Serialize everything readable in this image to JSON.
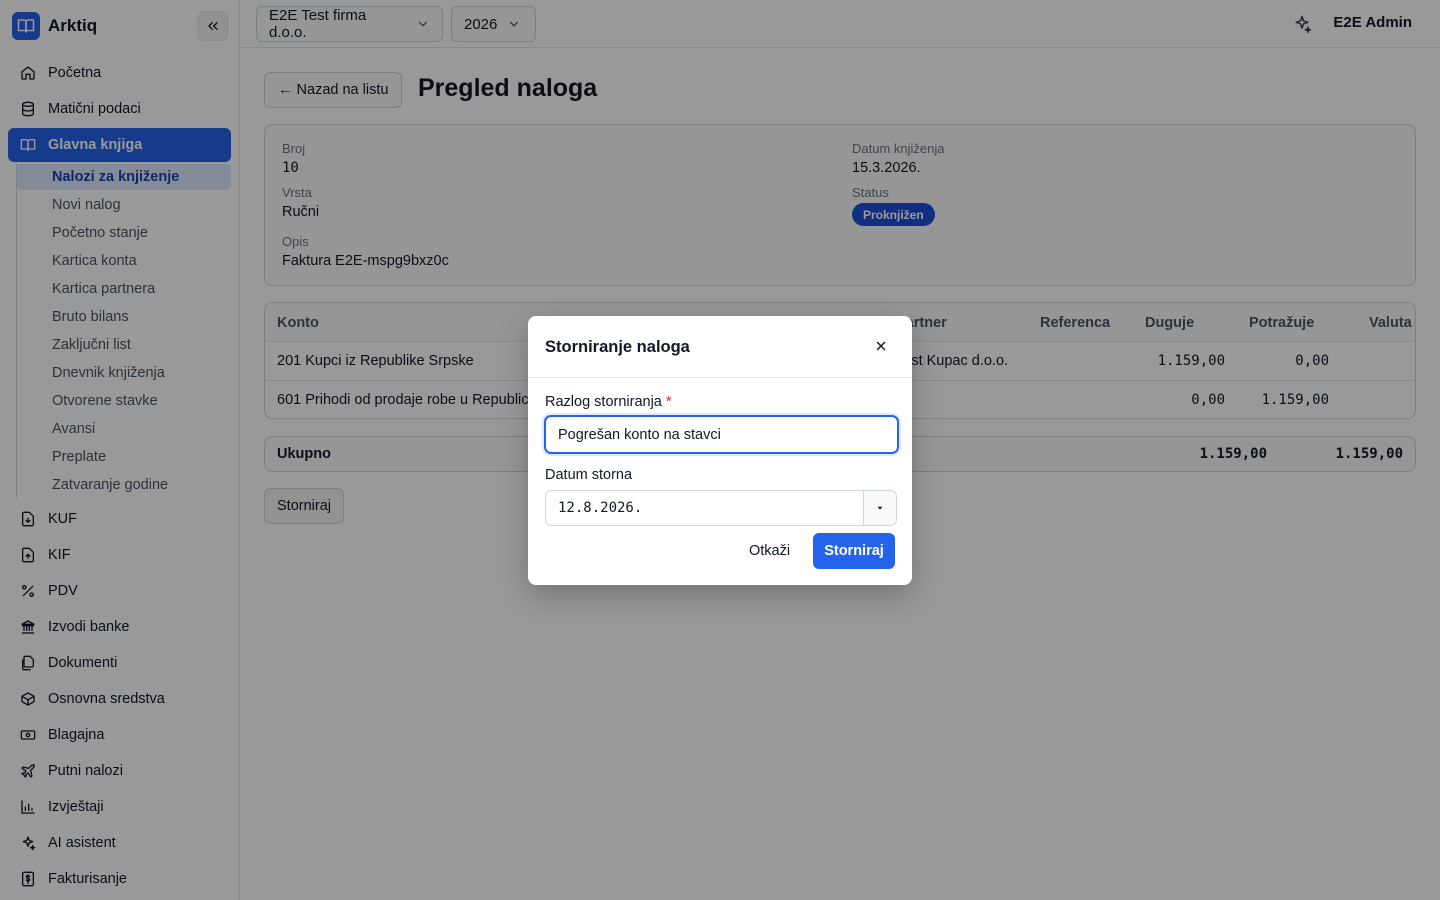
{
  "app": {
    "name": "Arktiq"
  },
  "topbar": {
    "company": "E2E Test firma d.o.o.",
    "year": "2026",
    "user": "E2E Admin"
  },
  "sidebar": {
    "items": [
      {
        "label": "Početna",
        "icon": "home-icon"
      },
      {
        "label": "Matični podaci",
        "icon": "database-icon"
      },
      {
        "label": "Glavna knjiga",
        "icon": "book-icon",
        "active": true
      },
      {
        "label": "KUF",
        "icon": "file-down-icon"
      },
      {
        "label": "KIF",
        "icon": "file-up-icon"
      },
      {
        "label": "PDV",
        "icon": "percent-icon"
      },
      {
        "label": "Izvodi banke",
        "icon": "bank-icon"
      },
      {
        "label": "Dokumenti",
        "icon": "files-icon"
      },
      {
        "label": "Osnovna sredstva",
        "icon": "box-icon"
      },
      {
        "label": "Blagajna",
        "icon": "cash-icon"
      },
      {
        "label": "Putni nalozi",
        "icon": "plane-icon"
      },
      {
        "label": "Izvještaji",
        "icon": "chart-icon"
      },
      {
        "label": "AI asistent",
        "icon": "sparkle-icon"
      },
      {
        "label": "Fakturisanje",
        "icon": "invoice-icon"
      }
    ],
    "sub_items": [
      "Nalozi za knjiženje",
      "Novi nalog",
      "Početno stanje",
      "Kartica konta",
      "Kartica partnera",
      "Bruto bilans",
      "Zaključni list",
      "Dnevnik knjiženja",
      "Otvorene stavke",
      "Avansi",
      "Preplate",
      "Zatvaranje godine"
    ]
  },
  "page": {
    "back_label": "← Nazad na listu",
    "title": "Pregled naloga",
    "fields": {
      "broj_label": "Broj",
      "broj": "10",
      "vrsta_label": "Vrsta",
      "vrsta": "Ručni",
      "opis_label": "Opis",
      "opis": "Faktura E2E-mspg9bxz0c",
      "datum_label": "Datum knjiženja",
      "datum": "15.3.2026.",
      "status_label": "Status",
      "status": "Proknjižen"
    },
    "table": {
      "headers": {
        "konto": "Konto",
        "partner": "Partner",
        "referenca": "Referenca",
        "duguje": "Duguje",
        "potrazuje": "Potražuje",
        "valuta": "Valuta"
      },
      "rows": [
        {
          "konto": "201 Kupci iz Republike Srpske",
          "partner": "Test Kupac d.o.o.",
          "referenca": "",
          "duguje": "1.159,00",
          "potrazuje": "0,00",
          "valuta": ""
        },
        {
          "konto": "601 Prihodi od prodaje robe u Republici Srpskoj",
          "partner": "",
          "referenca": "",
          "duguje": "0,00",
          "potrazuje": "1.159,00",
          "valuta": ""
        }
      ]
    },
    "total": {
      "label": "Ukupno",
      "duguje": "1.159,00",
      "potrazuje": "1.159,00"
    },
    "storno_button": "Storniraj"
  },
  "modal": {
    "title": "Storniranje naloga",
    "reason_label": "Razlog storniranja",
    "required_mark": "*",
    "reason_value": "Pogrešan konto na stavci",
    "date_label": "Datum storna",
    "date_value": "12.8.2026.",
    "cancel": "Otkaži",
    "confirm": "Storniraj"
  },
  "colors": {
    "accent": "#2563eb",
    "overlay": "rgba(0,0,0,0.4)"
  }
}
